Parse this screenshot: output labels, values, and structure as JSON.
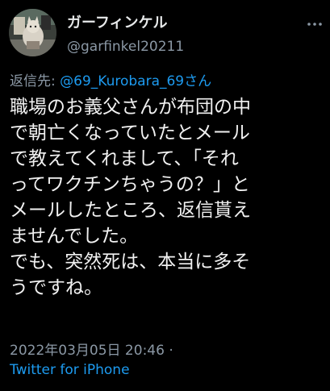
{
  "author": {
    "display_name": "ガーフィンケル",
    "handle": "@garfinkel20211"
  },
  "reply": {
    "prefix": "返信先: ",
    "target": "@69_Kurobara_69さん"
  },
  "tweet": {
    "lines": [
      "職場のお義父さんが布団の中",
      "で朝亡くなっていたとメール",
      "で教えてくれまして、「それ",
      "ってワクチンちゃうの？」と",
      "メールしたところ、返信貰え",
      "ませんでした。",
      "でも、突然死は、本当に多そ",
      "うですね。"
    ]
  },
  "meta": {
    "timestamp": "2022年03月05日 20:46 ·",
    "source": "Twitter for iPhone"
  },
  "colors": {
    "background": "#000000",
    "text": "#e7e9ea",
    "secondary": "#8b98a5",
    "link": "#1d9bf0"
  },
  "icons": {
    "more": "more-dots-icon",
    "avatar": "cat-avatar"
  }
}
